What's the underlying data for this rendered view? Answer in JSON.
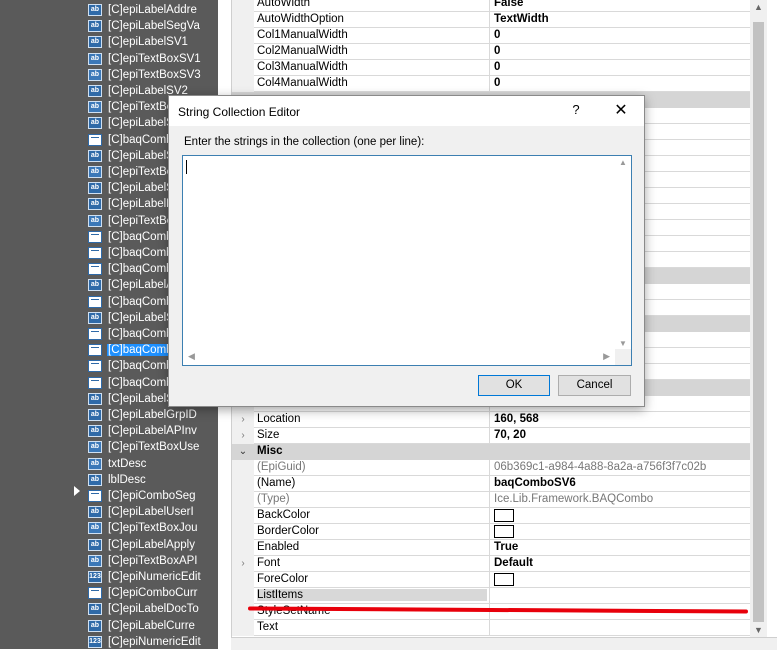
{
  "tree": {
    "items": [
      {
        "label": "[C]epiLabelAddre",
        "icon": "label-icon"
      },
      {
        "label": "[C]epiLabelSegVa",
        "icon": "label-icon"
      },
      {
        "label": "[C]epiLabelSV1",
        "icon": "label-icon"
      },
      {
        "label": "[C]epiTextBoxSV1",
        "icon": "textbox-icon"
      },
      {
        "label": "[C]epiTextBoxSV3",
        "icon": "textbox-icon"
      },
      {
        "label": "[C]epiLabelSV2",
        "icon": "label-icon"
      },
      {
        "label": "[C]epiTextBo",
        "icon": "textbox-icon"
      },
      {
        "label": "[C]epiLabelS",
        "icon": "label-icon"
      },
      {
        "label": "[C]baqCombo",
        "icon": "combo-icon"
      },
      {
        "label": "[C]epiLabelS",
        "icon": "label-icon"
      },
      {
        "label": "[C]epiTextBo",
        "icon": "textbox-icon"
      },
      {
        "label": "[C]epiLabelS",
        "icon": "label-icon"
      },
      {
        "label": "[C]epiLabelM",
        "icon": "label-icon"
      },
      {
        "label": "[C]epiTextBo",
        "icon": "textbox-icon"
      },
      {
        "label": "[C]baqComb",
        "icon": "combo-icon"
      },
      {
        "label": "[C]baqComb",
        "icon": "combo-icon"
      },
      {
        "label": "[C]baqComb",
        "icon": "combo-icon"
      },
      {
        "label": "[C]epiLabelA",
        "icon": "label-icon"
      },
      {
        "label": "[C]baqComb",
        "icon": "combo-icon"
      },
      {
        "label": "[C]epiLabelS",
        "icon": "label-icon"
      },
      {
        "label": "[C]baqComb",
        "icon": "combo-icon"
      },
      {
        "label": "[C]baqComb",
        "icon": "combo-icon",
        "selected": true
      },
      {
        "label": "[C]baqComb",
        "icon": "combo-icon"
      },
      {
        "label": "[C]baqComb",
        "icon": "combo-icon"
      },
      {
        "label": "[C]epiLabelS",
        "icon": "label-icon"
      },
      {
        "label": "[C]epiLabelGrpID",
        "icon": "label-icon"
      },
      {
        "label": "[C]epiLabelAPInv",
        "icon": "label-icon"
      },
      {
        "label": "[C]epiTextBoxUse",
        "icon": "textbox-icon"
      },
      {
        "label": "txtDesc",
        "icon": "textbox-icon"
      },
      {
        "label": "lblDesc",
        "icon": "label-icon"
      },
      {
        "label": "[C]epiComboSeg",
        "icon": "combo-icon"
      },
      {
        "label": "[C]epiLabelUserI",
        "icon": "label-icon"
      },
      {
        "label": "[C]epiTextBoxJou",
        "icon": "textbox-icon"
      },
      {
        "label": "[C]epiLabelApply",
        "icon": "label-icon"
      },
      {
        "label": "[C]epiTextBoxAPI",
        "icon": "textbox-icon"
      },
      {
        "label": "[C]epiNumericEdit",
        "icon": "numeric-icon"
      },
      {
        "label": "[C]epiComboCurr",
        "icon": "combo-icon"
      },
      {
        "label": "[C]epiLabelDocTo",
        "icon": "label-icon"
      },
      {
        "label": "[C]epiLabelCurre",
        "icon": "label-icon"
      },
      {
        "label": "[C]epiNumericEdit",
        "icon": "numeric-icon"
      },
      {
        "label": "[C]epiNumericEdit",
        "icon": "numeric-icon"
      }
    ]
  },
  "properties": {
    "top_rows": [
      {
        "name": "AutoWidth",
        "value": "False"
      },
      {
        "name": "AutoWidthOption",
        "value": "TextWidth"
      },
      {
        "name": "Col1ManualWidth",
        "value": "0"
      },
      {
        "name": "Col2ManualWidth",
        "value": "0"
      },
      {
        "name": "Col3ManualWidth",
        "value": "0"
      },
      {
        "name": "Col4ManualWidth",
        "value": "0"
      }
    ],
    "location": {
      "name": "Location",
      "value": "160, 568"
    },
    "size": {
      "name": "Size",
      "value": "70, 20"
    },
    "misc_category": "Misc",
    "misc_rows": [
      {
        "name": "(EpiGuid)",
        "value": "06b369c1-a984-4a88-8a2a-a756f3f7c02b",
        "muted": true
      },
      {
        "name": "(Name)",
        "value": "baqComboSV6"
      },
      {
        "name": "(Type)",
        "value": "Ice.Lib.Framework.BAQCombo",
        "muted": true
      },
      {
        "name": "BackColor",
        "value": "",
        "color": "#ffffff"
      },
      {
        "name": "BorderColor",
        "value": "",
        "color": "#ffffff"
      },
      {
        "name": "Enabled",
        "value": "True"
      },
      {
        "name": "Font",
        "value": "Default",
        "expand": true
      },
      {
        "name": "ForeColor",
        "value": "",
        "color": "#ffffff"
      },
      {
        "name": "ListItems",
        "value": "",
        "selected": true
      },
      {
        "name": "StyleSetName",
        "value": ""
      },
      {
        "name": "Text",
        "value": ""
      }
    ]
  },
  "dialog": {
    "title": "String Collection Editor",
    "help": "?",
    "close": "✕",
    "instruction": "Enter the strings in the collection (one per line):",
    "text_value": "",
    "ok_label": "OK",
    "cancel_label": "Cancel"
  },
  "colors": {
    "tree_bg": "#5a5a5a",
    "selection": "#1e90ff",
    "annotation_line": "#e8000b",
    "dialog_accent": "#0078d7"
  }
}
